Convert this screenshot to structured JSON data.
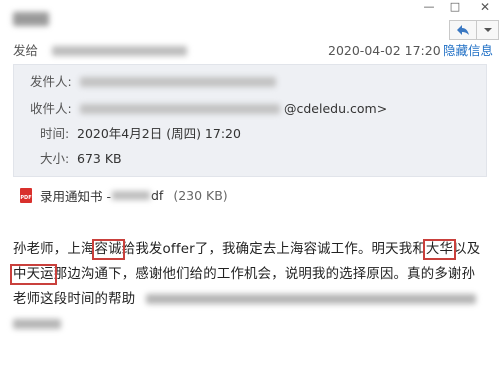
{
  "window": {
    "controls": {
      "minimize": "—",
      "maximize": "□",
      "close": "✕"
    }
  },
  "header": {
    "send_label": "发给",
    "date": "2020-04-02 17:20",
    "hide_info": "隐藏信息"
  },
  "details": {
    "from_label": "发件人:",
    "to_label": "收件人:",
    "to_visible": "@cdeledu.com>",
    "time_label": "时间:",
    "time_value": "2020年4月2日 (周四) 17:20",
    "size_label": "大小:",
    "size_value": "673 KB"
  },
  "attachment": {
    "icon": "pdf-icon",
    "icon_text": "PDF",
    "name_prefix": "录用通知书 -",
    "name_suffix": "df",
    "size": "(230 KB)"
  },
  "body": {
    "line1_a": "孙老师，上海",
    "line1_hl1": "容诚",
    "line1_b": "给我发offer了，我确定去上海容诚工作。明天我和",
    "line1_hl2": "大华",
    "line1_c": "以及",
    "line2_hl": "中天运",
    "line2_b": "那边沟通下，感谢他们给的工作机会，说明我的选择原因。真的多谢孙",
    "line3_a": "老师这段时间的帮助"
  }
}
